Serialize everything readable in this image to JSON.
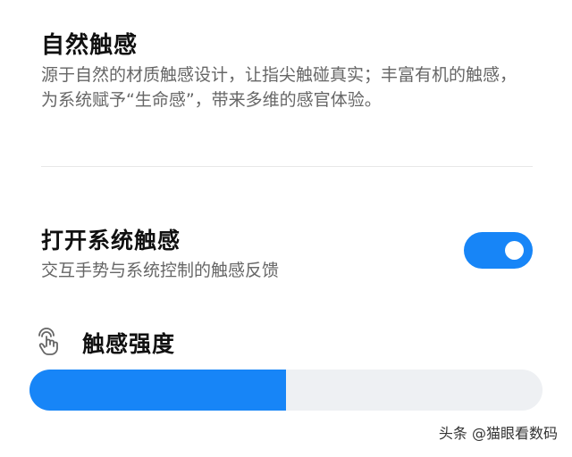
{
  "natural_haptics": {
    "title": "自然触感",
    "description": "源于自然的材质触感设计，让指尖触碰真实；丰富有机的触感，为系统赋予“生命感”，带来多维的感官体验。"
  },
  "system_haptics": {
    "title": "打开系统触感",
    "description": "交互手势与系统控制的触感反馈",
    "enabled": true,
    "accent_color": "#1785f7"
  },
  "intensity": {
    "icon": "touch-finger-icon",
    "label": "触感强度",
    "value_fraction": 0.5
  },
  "watermark": "头条 @猫眼看数码"
}
